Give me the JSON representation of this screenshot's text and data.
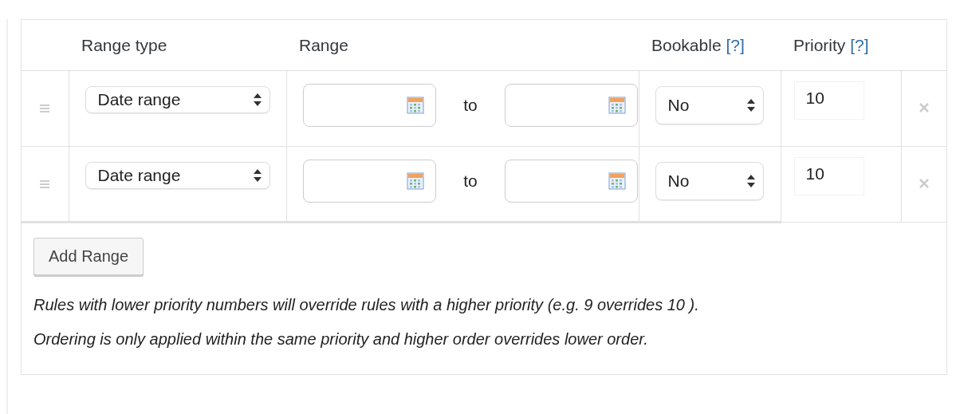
{
  "table": {
    "columns": [
      {
        "label": "Range type"
      },
      {
        "label": "Range"
      },
      {
        "label": "Bookable",
        "help": "[?]"
      },
      {
        "label": "Priority",
        "help": "[?]"
      }
    ],
    "rows": [
      {
        "range_type": "Date range",
        "from": "",
        "separator": "to",
        "to": "",
        "bookable": "No",
        "priority": "10"
      },
      {
        "range_type": "Date range",
        "from": "",
        "separator": "to",
        "to": "",
        "bookable": "No",
        "priority": "10"
      }
    ]
  },
  "add_button": "Add Range",
  "note": "Rules with lower priority numbers will override rules with a higher priority (e.g. 9 overrides 10 ). Ordering is only applied within the same priority and higher order overrides lower order."
}
